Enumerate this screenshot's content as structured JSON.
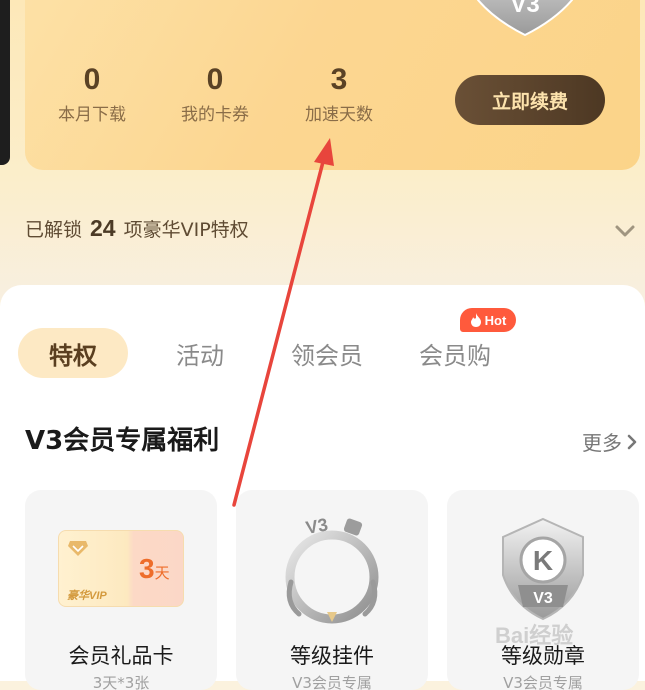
{
  "vip_card": {
    "badge_level": "V3",
    "stats": [
      {
        "value": "0",
        "label": "本月下载"
      },
      {
        "value": "0",
        "label": "我的卡券"
      },
      {
        "value": "3",
        "label": "加速天数"
      }
    ],
    "renew_label": "立即续费"
  },
  "unlock": {
    "prefix": "已解锁",
    "count": "24",
    "suffix": "项豪华VIP特权"
  },
  "tabs": [
    {
      "label": "特权",
      "active": true
    },
    {
      "label": "活动",
      "active": false
    },
    {
      "label": "领会员",
      "active": false
    },
    {
      "label": "会员购",
      "active": false
    }
  ],
  "hot_badge": "Hot",
  "section": {
    "title": "V3会员专属福利",
    "more": "更多"
  },
  "benefits": [
    {
      "name": "会员礼品卡",
      "sub": "3天*3张",
      "icon": "gift-card-icon"
    },
    {
      "name": "等级挂件",
      "sub": "V3会员专属",
      "icon": "level-pendant-icon"
    },
    {
      "name": "等级勋章",
      "sub": "V3会员专属",
      "icon": "level-medal-icon"
    }
  ],
  "gift_card": {
    "days": "3",
    "unit": "天",
    "vip_text": "豪华VIP"
  },
  "medal": {
    "letter": "K",
    "level": "V3"
  },
  "pendant": {
    "level": "V3"
  },
  "watermark": "Bai经验",
  "colors": {
    "accent_dark": "#4d3823",
    "accent_gold": "#fde3ad",
    "hot": "#ff5a3c",
    "annotation_arrow": "#e8453c"
  }
}
